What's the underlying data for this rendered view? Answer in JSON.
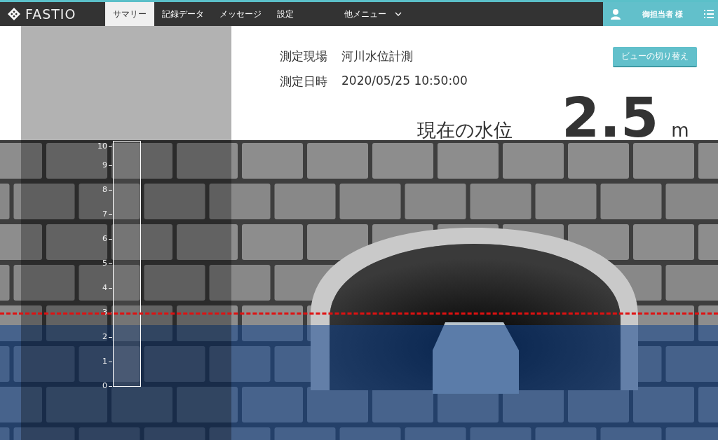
{
  "nav": {
    "logo": "FASTIO",
    "tabs": [
      {
        "label": "サマリー",
        "selected": true,
        "kind": "link"
      },
      {
        "label": "記録データ",
        "selected": false,
        "kind": "link"
      },
      {
        "label": "メッセージ",
        "selected": false,
        "kind": "link"
      },
      {
        "label": "設定",
        "selected": false,
        "kind": "link"
      },
      {
        "label": "他メニュー",
        "selected": false,
        "kind": "dropdown"
      }
    ],
    "user": "御担当者 様"
  },
  "header": {
    "fields": [
      {
        "label": "測定現場",
        "value": "河川水位計測"
      },
      {
        "label": "測定日時",
        "value": "2020/05/25 10:50:00"
      }
    ],
    "view_button": "ビューの切り替え",
    "reading": {
      "label": "現在の水位",
      "value": "2.5",
      "unit": "m"
    }
  },
  "gauge": {
    "ticks": [
      "10",
      "9",
      "8",
      "7",
      "6",
      "5",
      "4",
      "3",
      "2",
      "1",
      "0"
    ]
  },
  "water": {
    "level": 0.25
  },
  "alert_line": {
    "level": 0.3
  }
}
